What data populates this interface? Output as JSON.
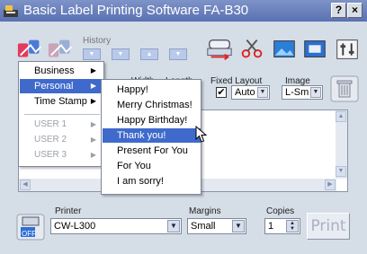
{
  "window": {
    "title": "Basic Label Printing Software FA-B30",
    "help_label": "?",
    "close_label": "×"
  },
  "toolbar": {
    "history_label": "History",
    "width_label": "Width",
    "length_label": "Length",
    "fixed_layout_label": "Fixed Layout",
    "image_label": "Image",
    "fixed_layout_value": "Auto",
    "image_value": "L-Sm",
    "checkbox_mark": "✔"
  },
  "menu_main": {
    "items": [
      {
        "label": "Business"
      },
      {
        "label": "Personal"
      },
      {
        "label": "Time Stamp"
      },
      {
        "label": "USER 1"
      },
      {
        "label": "USER 2"
      },
      {
        "label": "USER 3"
      }
    ]
  },
  "menu_sub": {
    "items": [
      {
        "label": "Happy!"
      },
      {
        "label": "Merry Christmas!"
      },
      {
        "label": "Happy Birthday!"
      },
      {
        "label": "Thank you!"
      },
      {
        "label": "Present For You"
      },
      {
        "label": "For You"
      },
      {
        "label": "I am sorry!"
      }
    ]
  },
  "bottom": {
    "off_label": "OFF",
    "printer_label": "Printer",
    "printer_value": "CW-L300",
    "margins_label": "Margins",
    "margins_value": "Small",
    "copies_label": "Copies",
    "copies_value": "1",
    "print_label": "Print"
  },
  "colors": {
    "title_bar": "#5a71b2",
    "menu_highlight": "#3f6acb",
    "panel": "#d5dde7"
  }
}
